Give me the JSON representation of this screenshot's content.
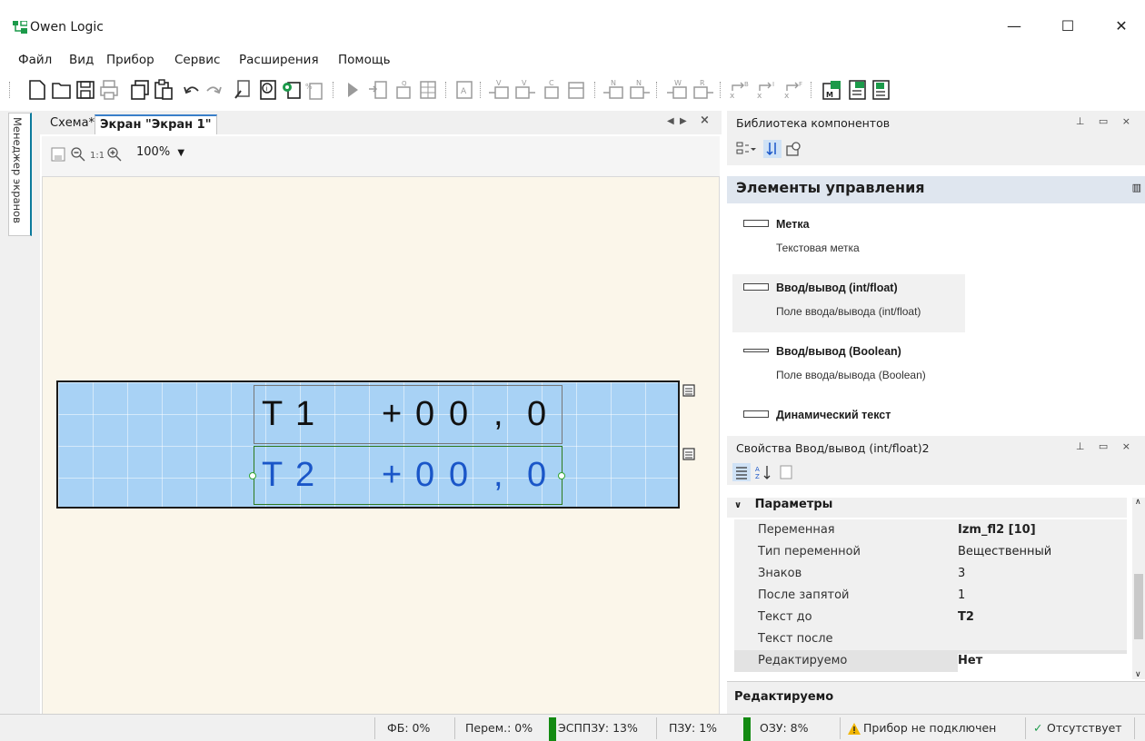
{
  "window": {
    "title": "Owen Logic",
    "minimize": "—",
    "maximize": "☐",
    "close": "✕"
  },
  "menu": [
    "Файл",
    "Вид",
    "Прибор",
    "Сервис",
    "Расширения",
    "Помощь"
  ],
  "side_panel": {
    "label": "Менеджер экранов"
  },
  "tabs": [
    {
      "label": "Схема*",
      "active": false
    },
    {
      "label": "Экран \"Экран 1\"",
      "active": true
    }
  ],
  "editor": {
    "zoom": "100%",
    "fields": [
      {
        "prefix": [
          "Т",
          "1"
        ],
        "sign": "+",
        "digits": [
          "0",
          "0"
        ],
        "comma": ",",
        "frac": "0"
      },
      {
        "prefix": [
          "Т",
          "2"
        ],
        "sign": "+",
        "digits": [
          "0",
          "0"
        ],
        "comma": ",",
        "frac": "0"
      }
    ]
  },
  "library": {
    "title": "Библиотека компонентов",
    "group": "Элементы управления",
    "items": [
      {
        "name": "Метка",
        "desc": "Текстовая метка"
      },
      {
        "name": "Ввод/вывод (int/float)",
        "desc": "Поле ввода/вывода (int/float)"
      },
      {
        "name": "Ввод/вывод (Boolean)",
        "desc": "Поле ввода/вывода (Boolean)"
      },
      {
        "name": "Динамический текст",
        "desc": ""
      }
    ]
  },
  "properties": {
    "title": "Свойства Ввод/вывод (int/float)2",
    "section": "Параметры",
    "rows": [
      {
        "key": "Переменная",
        "value": "Izm_fl2 [10]",
        "bold": true
      },
      {
        "key": "Тип переменной",
        "value": "Вещественный",
        "bold": false
      },
      {
        "key": "Знаков",
        "value": "3",
        "bold": false
      },
      {
        "key": "После запятой",
        "value": "1",
        "bold": false
      },
      {
        "key": "Текст до",
        "value": "Т2",
        "bold": true
      },
      {
        "key": "Текст после",
        "value": "",
        "bold": false
      },
      {
        "key": "Редактируемо",
        "value": "Нет",
        "bold": true
      }
    ],
    "description": "Редактируемо"
  },
  "status": {
    "fb": "ФБ: 0%",
    "vars": "Перем.: 0%",
    "esppzu": "ЭСППЗУ: 13%",
    "pzu": "ПЗУ: 1%",
    "ozu": "ОЗУ: 8%",
    "device": "Прибор не подключен",
    "absent": "Отсутствует"
  }
}
